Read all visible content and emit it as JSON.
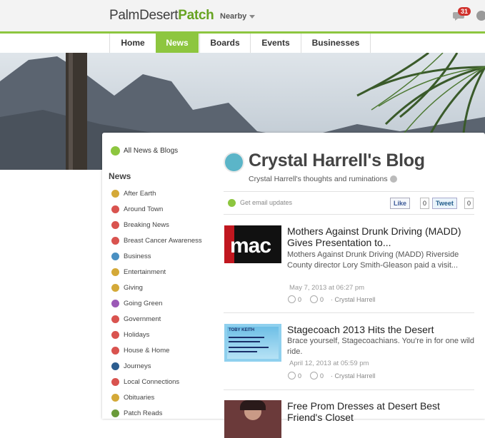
{
  "header": {
    "logo_city": "PalmDesert",
    "logo_patch": "Patch",
    "nearby_label": "Nearby",
    "notification_count": "31"
  },
  "nav": {
    "tabs": [
      {
        "label": "Home"
      },
      {
        "label": "News"
      },
      {
        "label": "Boards"
      },
      {
        "label": "Events"
      },
      {
        "label": "Businesses"
      }
    ],
    "active": "News"
  },
  "sidebar": {
    "all_news": "All News & Blogs",
    "section_title": "News",
    "categories": [
      {
        "label": "After Earth",
        "icon": "globe-icon",
        "color": "#d4a938"
      },
      {
        "label": "Around Town",
        "icon": "car-icon",
        "color": "#d9534f"
      },
      {
        "label": "Breaking News",
        "icon": "alert-icon",
        "color": "#d9534f"
      },
      {
        "label": "Breast Cancer Awareness",
        "icon": "plus-icon",
        "color": "#d9534f"
      },
      {
        "label": "Business",
        "icon": "building-icon",
        "color": "#4a90c2"
      },
      {
        "label": "Entertainment",
        "icon": "star-icon",
        "color": "#d4a938"
      },
      {
        "label": "Giving",
        "icon": "gift-icon",
        "color": "#d4a938"
      },
      {
        "label": "Going Green",
        "icon": "leaf-icon",
        "color": "#9b59b6"
      },
      {
        "label": "Government",
        "icon": "capitol-icon",
        "color": "#d9534f"
      },
      {
        "label": "Holidays",
        "icon": "holiday-icon",
        "color": "#d9534f"
      },
      {
        "label": "House & Home",
        "icon": "house-icon",
        "color": "#d9534f"
      },
      {
        "label": "Journeys",
        "icon": "journey-icon",
        "color": "#2c5d8f"
      },
      {
        "label": "Local Connections",
        "icon": "connection-icon",
        "color": "#d9534f"
      },
      {
        "label": "Obituaries",
        "icon": "obituary-icon",
        "color": "#d4a938"
      },
      {
        "label": "Patch Reads",
        "icon": "book-icon",
        "color": "#6a9a3a"
      }
    ]
  },
  "blog": {
    "title": "Crystal Harrell's Blog",
    "subtitle": "Crystal Harrell's thoughts and ruminations",
    "email_updates": "Get email updates",
    "like_label": "Like",
    "like_count": "0",
    "tweet_label": "Tweet",
    "tweet_count": "0"
  },
  "posts": [
    {
      "title": "Mothers Against Drunk Driving (MADD) Gives Presentation to...",
      "excerpt": "Mothers Against Drunk Driving (MADD) Riverside County director Lory Smith-Gleason paid a visit...",
      "date": "May 7, 2013 at 06:27 pm",
      "comments": "0",
      "views": "0",
      "author": "· Crystal Harrell",
      "thumb_text": "mac"
    },
    {
      "title": "Stagecoach 2013 Hits the Desert",
      "excerpt": "Brace yourself, Stagecoachians. You're in for one wild ride.",
      "date": "April 12, 2013 at 05:59 pm",
      "comments": "0",
      "views": "0",
      "author": "· Crystal Harrell",
      "thumb_text": "TOBY KEITH"
    },
    {
      "title": "Free Prom Dresses at Desert Best Friend's Closet"
    }
  ]
}
